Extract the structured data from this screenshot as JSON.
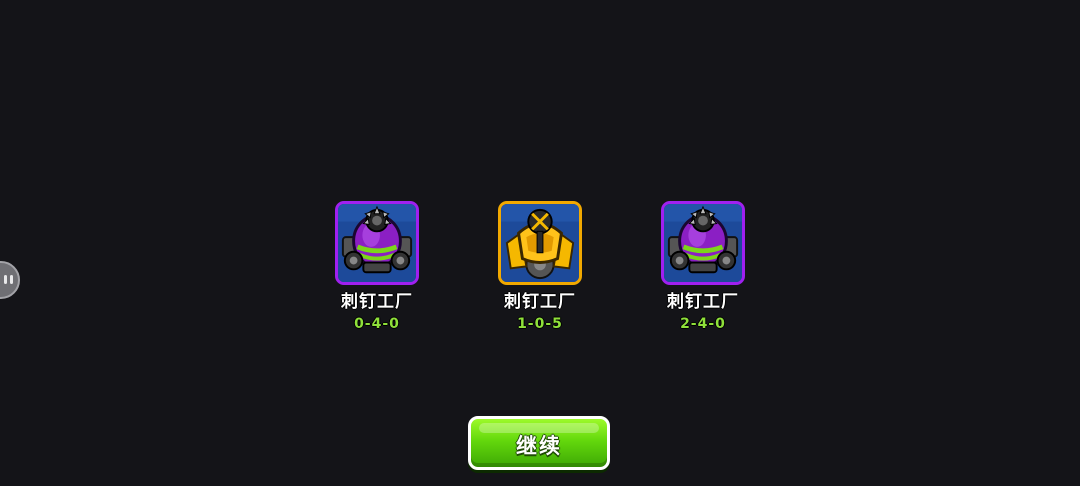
{
  "theme": {
    "background": "#141418",
    "path_text_color": "#8fe03a",
    "button_green": "#63d80c",
    "purple_border": "#a020f0",
    "gold_border": "#f2a900"
  },
  "towers": [
    {
      "name": "刺钉工厂",
      "path": "0-4-0",
      "icon": "spike-factory-purple-icon",
      "border": "purple"
    },
    {
      "name": "刺钉工厂",
      "path": "1-0-5",
      "icon": "spike-factory-gold-icon",
      "border": "gold"
    },
    {
      "name": "刺钉工厂",
      "path": "2-4-0",
      "icon": "spike-factory-purple-icon",
      "border": "purple"
    }
  ],
  "continue_button": {
    "label": "继续"
  },
  "side_handle": {
    "icon": "floating-assistant-icon"
  }
}
